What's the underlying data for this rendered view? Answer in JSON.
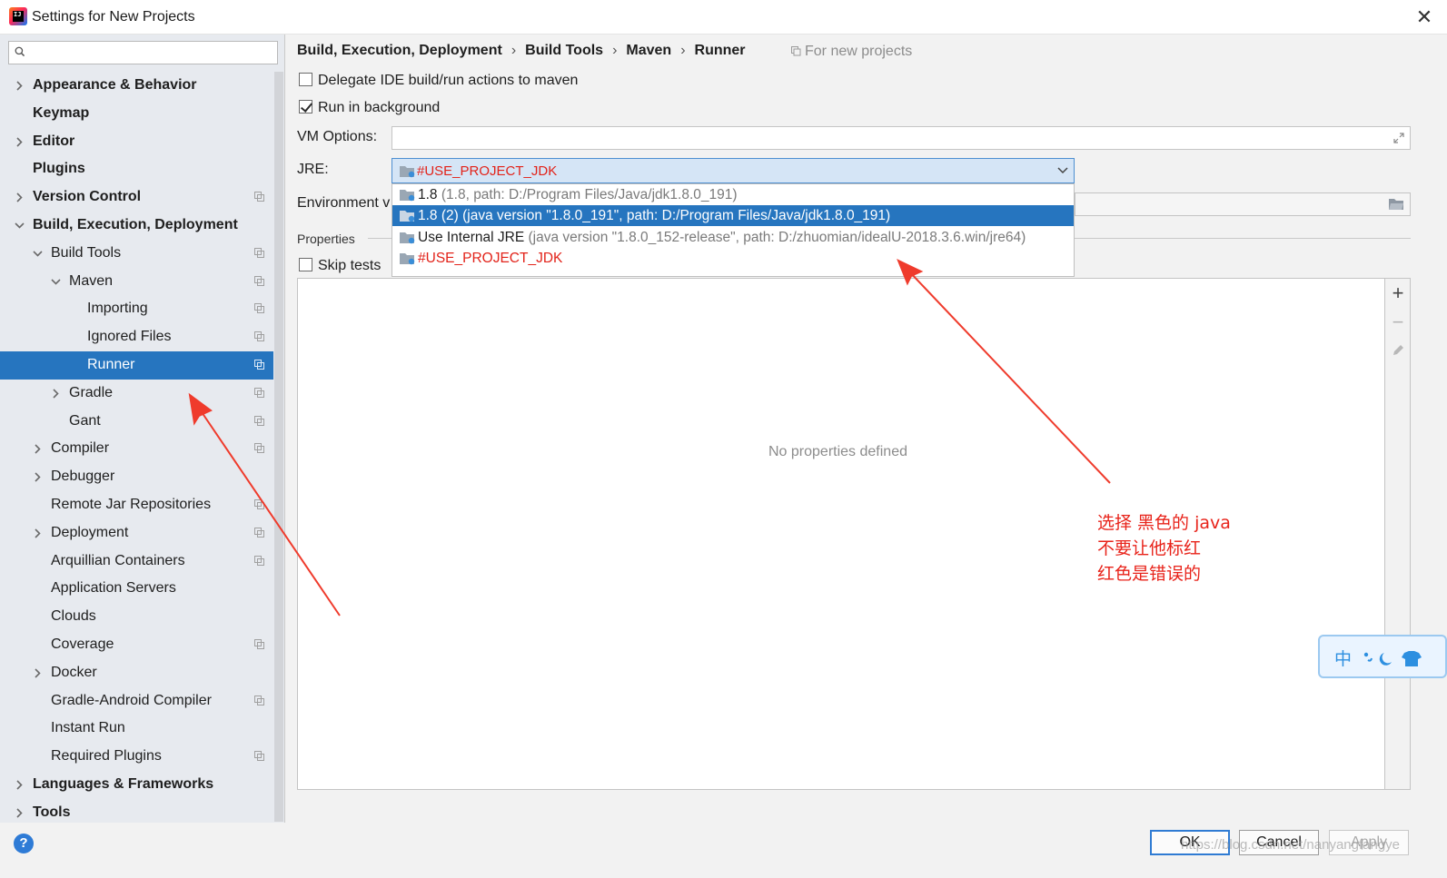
{
  "window": {
    "title": "Settings for New Projects",
    "close": "✕"
  },
  "search": {
    "placeholder": ""
  },
  "tree": {
    "items": [
      {
        "label": "Appearance & Behavior",
        "level": 0,
        "bold": true,
        "expander": "collapsed",
        "project_icon": false
      },
      {
        "label": "Keymap",
        "level": 0,
        "bold": true,
        "expander": "none",
        "project_icon": false
      },
      {
        "label": "Editor",
        "level": 0,
        "bold": true,
        "expander": "collapsed",
        "project_icon": false
      },
      {
        "label": "Plugins",
        "level": 0,
        "bold": true,
        "expander": "none",
        "project_icon": false
      },
      {
        "label": "Version Control",
        "level": 0,
        "bold": true,
        "expander": "collapsed",
        "project_icon": true
      },
      {
        "label": "Build, Execution, Deployment",
        "level": 0,
        "bold": true,
        "expander": "expanded",
        "project_icon": false
      },
      {
        "label": "Build Tools",
        "level": 1,
        "bold": false,
        "expander": "expanded",
        "project_icon": true
      },
      {
        "label": "Maven",
        "level": 2,
        "bold": false,
        "expander": "expanded",
        "project_icon": true
      },
      {
        "label": "Importing",
        "level": 3,
        "bold": false,
        "expander": "none",
        "project_icon": true
      },
      {
        "label": "Ignored Files",
        "level": 3,
        "bold": false,
        "expander": "none",
        "project_icon": true
      },
      {
        "label": "Runner",
        "level": 3,
        "bold": false,
        "expander": "none",
        "project_icon": true,
        "selected": true
      },
      {
        "label": "Gradle",
        "level": 2,
        "bold": false,
        "expander": "collapsed",
        "project_icon": true
      },
      {
        "label": "Gant",
        "level": 2,
        "bold": false,
        "expander": "none",
        "project_icon": true
      },
      {
        "label": "Compiler",
        "level": 1,
        "bold": false,
        "expander": "collapsed",
        "project_icon": true
      },
      {
        "label": "Debugger",
        "level": 1,
        "bold": false,
        "expander": "collapsed",
        "project_icon": false
      },
      {
        "label": "Remote Jar Repositories",
        "level": 1,
        "bold": false,
        "expander": "none",
        "project_icon": true
      },
      {
        "label": "Deployment",
        "level": 1,
        "bold": false,
        "expander": "collapsed",
        "project_icon": true
      },
      {
        "label": "Arquillian Containers",
        "level": 1,
        "bold": false,
        "expander": "none",
        "project_icon": true
      },
      {
        "label": "Application Servers",
        "level": 1,
        "bold": false,
        "expander": "none",
        "project_icon": false
      },
      {
        "label": "Clouds",
        "level": 1,
        "bold": false,
        "expander": "none",
        "project_icon": false
      },
      {
        "label": "Coverage",
        "level": 1,
        "bold": false,
        "expander": "none",
        "project_icon": true
      },
      {
        "label": "Docker",
        "level": 1,
        "bold": false,
        "expander": "collapsed",
        "project_icon": false
      },
      {
        "label": "Gradle-Android Compiler",
        "level": 1,
        "bold": false,
        "expander": "none",
        "project_icon": true
      },
      {
        "label": "Instant Run",
        "level": 1,
        "bold": false,
        "expander": "none",
        "project_icon": false
      },
      {
        "label": "Required Plugins",
        "level": 1,
        "bold": false,
        "expander": "none",
        "project_icon": true
      },
      {
        "label": "Languages & Frameworks",
        "level": 0,
        "bold": true,
        "expander": "collapsed",
        "project_icon": false
      },
      {
        "label": "Tools",
        "level": 0,
        "bold": true,
        "expander": "collapsed",
        "project_icon": false
      }
    ]
  },
  "breadcrumb": {
    "items": [
      "Build, Execution, Deployment",
      "Build Tools",
      "Maven",
      "Runner"
    ],
    "separator": "›",
    "scope": "For new projects"
  },
  "options": {
    "delegate": {
      "label": "Delegate IDE build/run actions to maven",
      "checked": false
    },
    "background": {
      "label": "Run in background",
      "checked": true
    },
    "vm_label": "VM Options:",
    "vm_value": "",
    "jre_label": "JRE:",
    "jre_value": "#USE_PROJECT_JDK",
    "env_label": "Environment v",
    "properties_label": "Properties",
    "skip_tests": {
      "label": "Skip tests",
      "checked": false
    }
  },
  "jre_popup": {
    "items": [
      {
        "main": "1.8",
        "detail": " (1.8, path: D:/Program Files/Java/jdk1.8.0_191)",
        "highlighted": false,
        "error": false
      },
      {
        "main": "1.8 (2)",
        "detail": " (java version \"1.8.0_191\", path: D:/Program Files/Java/jdk1.8.0_191)",
        "highlighted": true,
        "error": false
      },
      {
        "main": "Use Internal JRE",
        "detail": " (java version \"1.8.0_152-release\", path: D:/zhuomian/idealU-2018.3.6.win/jre64)",
        "highlighted": false,
        "error": false
      },
      {
        "main": "#USE_PROJECT_JDK",
        "detail": "",
        "highlighted": false,
        "error": true
      }
    ]
  },
  "properties_table": {
    "empty_text": "No properties defined",
    "add": "+",
    "remove": "−"
  },
  "footer": {
    "help": "?",
    "ok": "OK",
    "cancel": "Cancel",
    "apply": "Apply"
  },
  "annotation": {
    "lines": [
      "选择 黑色的 java",
      "不要让他标红",
      "红色是错误的"
    ],
    "color": "#e8231a"
  },
  "watermark": "https://blog.csdn.net/nanyangfangye",
  "ime": {
    "char": "中",
    "extra": "°,"
  },
  "colors": {
    "selection": "#2675bf",
    "error": "#e2231a",
    "sidebar_bg": "#e7eaef",
    "panel_bg": "#f2f2f2"
  }
}
